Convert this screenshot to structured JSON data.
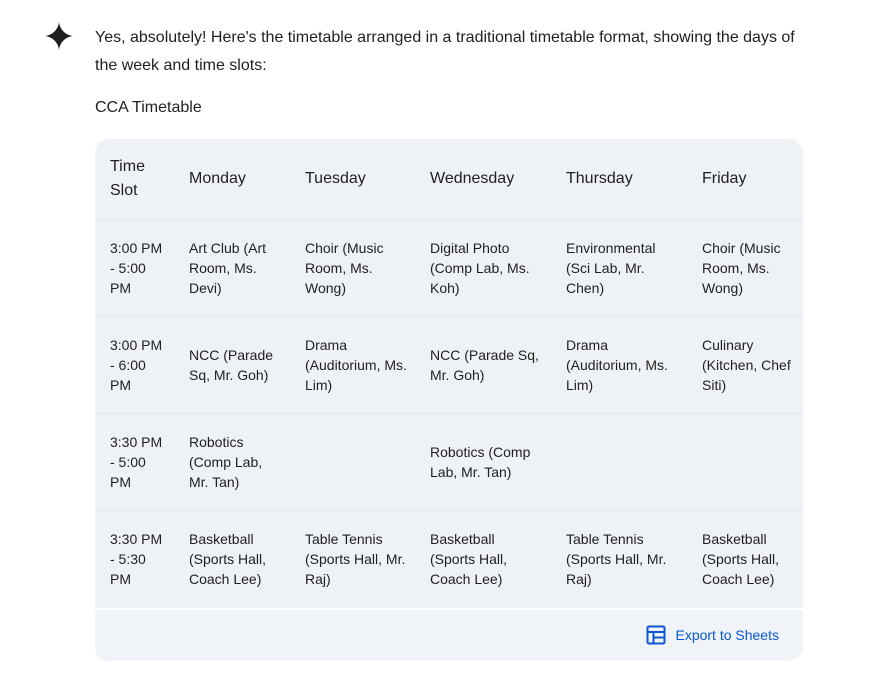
{
  "response": {
    "intro_text": "Yes, absolutely! Here's the timetable arranged in a traditional timetable format, showing the days of the week and time slots:",
    "heading": "CCA Timetable",
    "icon": "sparkle-icon"
  },
  "timetable": {
    "headers": [
      "Time Slot",
      "Monday",
      "Tuesday",
      "Wednesday",
      "Thursday",
      "Friday"
    ],
    "rows": [
      {
        "time": "3:00 PM - 5:00 PM",
        "cells": [
          "Art Club (Art Room, Ms. Devi)",
          "Choir (Music Room, Ms. Wong)",
          "Digital Photo (Comp Lab, Ms. Koh)",
          "Environmental (Sci Lab, Mr. Chen)",
          "Choir (Music Room, Ms. Wong)"
        ]
      },
      {
        "time": "3:00 PM - 6:00 PM",
        "cells": [
          "NCC (Parade Sq, Mr. Goh)",
          "Drama (Auditorium, Ms. Lim)",
          "NCC (Parade Sq, Mr. Goh)",
          "Drama (Auditorium, Ms. Lim)",
          "Culinary (Kitchen, Chef Siti)"
        ]
      },
      {
        "time": "3:30 PM - 5:00 PM",
        "cells": [
          "Robotics (Comp Lab, Mr. Tan)",
          "",
          "Robotics (Comp Lab, Mr. Tan)",
          "",
          ""
        ]
      },
      {
        "time": "3:30 PM - 5:30 PM",
        "cells": [
          "Basketball (Sports Hall, Coach Lee)",
          "Table Tennis (Sports Hall, Mr. Raj)",
          "Basketball (Sports Hall, Coach Lee)",
          "Table Tennis (Sports Hall, Mr. Raj)",
          "Basketball (Sports Hall, Coach Lee)"
        ]
      }
    ]
  },
  "footer": {
    "export_label": "Export to Sheets",
    "export_icon": "sheets-table-icon"
  },
  "colors": {
    "accent": "#0b57d0",
    "table_bg": "#eef1f6",
    "text": "#1f1f1f"
  }
}
